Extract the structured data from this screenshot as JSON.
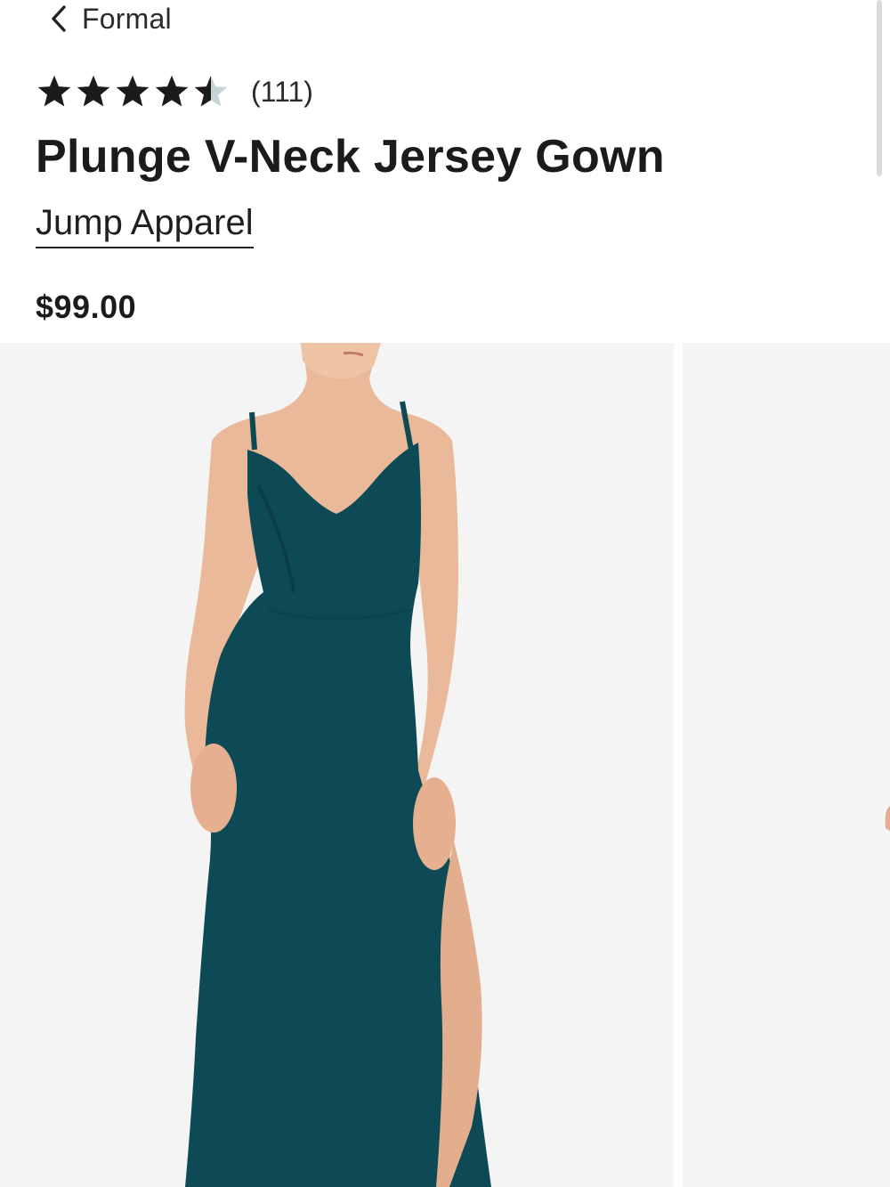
{
  "nav": {
    "back_label": "Formal"
  },
  "product": {
    "rating": {
      "value": 4.5,
      "max": 5,
      "count_label": "(111)",
      "star_color": "#1b1b1b",
      "empty_star_color": "#c7d3d6"
    },
    "title": "Plunge V-Neck Jersey Gown",
    "brand": "Jump Apparel",
    "price": "$99.00"
  },
  "gallery": {
    "images": [
      {
        "subject": "model-in-green-gown",
        "dress_color": "#0d4a55",
        "background": "#f4f4f4"
      },
      {
        "subject": "next-image-preview",
        "background": "#f4f4f4"
      }
    ]
  }
}
